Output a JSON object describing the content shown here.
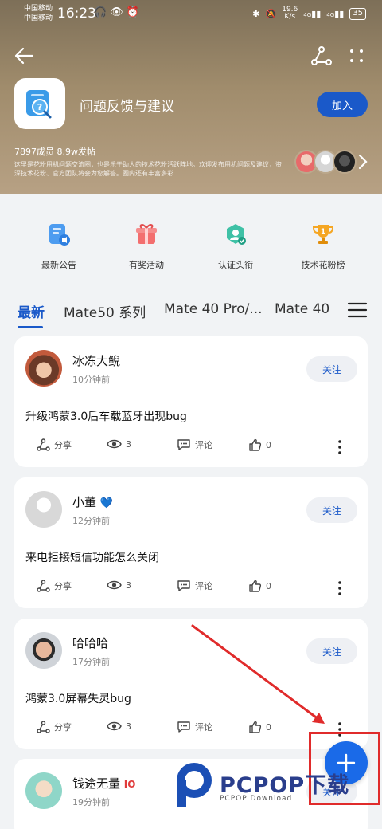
{
  "status_bar": {
    "carrier_1": "中国移动",
    "carrier_2": "中国移动",
    "time": "16:23",
    "net_speed": "19.6",
    "net_unit": "K/s",
    "signal_1": "4G",
    "signal_2": "4G",
    "battery": "35"
  },
  "forum": {
    "title": "问题反馈与建议",
    "join_label": "加入",
    "stats": "7897成员 8.9w发帖",
    "description": "这里是花粉用机问题交流圈，也是乐于助人的技术花粉活跃阵地。欢迎发布用机问题及建议，资深技术花粉、官方团队将会为您解答。圈内还有丰富多彩..."
  },
  "quick_links": [
    {
      "label": "最新公告",
      "icon": "announcement-icon"
    },
    {
      "label": "有奖活动",
      "icon": "gift-icon"
    },
    {
      "label": "认证头衔",
      "icon": "badge-icon"
    },
    {
      "label": "技术花粉榜",
      "icon": "trophy-icon"
    }
  ],
  "tabs": [
    "最新",
    "Mate50 系列",
    "Mate 40 Pro/...",
    "Mate 40"
  ],
  "posts": [
    {
      "author": "冰冻大鲵",
      "time": "10分钟前",
      "follow": "关注",
      "title": "升级鸿蒙3.0后车载蓝牙出现bug",
      "share": "分享",
      "views": "3",
      "comment": "评论",
      "likes": "0"
    },
    {
      "author": "小董",
      "time": "12分钟前",
      "follow": "关注",
      "title": "来电拒接短信功能怎么关闭",
      "share": "分享",
      "views": "3",
      "comment": "评论",
      "likes": "0"
    },
    {
      "author": "哈哈哈",
      "time": "17分钟前",
      "follow": "关注",
      "title": "鸿蒙3.0屏幕失灵bug",
      "share": "分享",
      "views": "3",
      "comment": "评论",
      "likes": "0"
    },
    {
      "author": "钱途无量",
      "time": "19分钟前",
      "follow": "关注"
    }
  ],
  "watermark": {
    "brand": "PCPOP下载",
    "sub": "PCPOP Download"
  },
  "colors": {
    "accent": "#1a59c9",
    "fab": "#1a6ae8",
    "annotation": "#e02b2b"
  }
}
